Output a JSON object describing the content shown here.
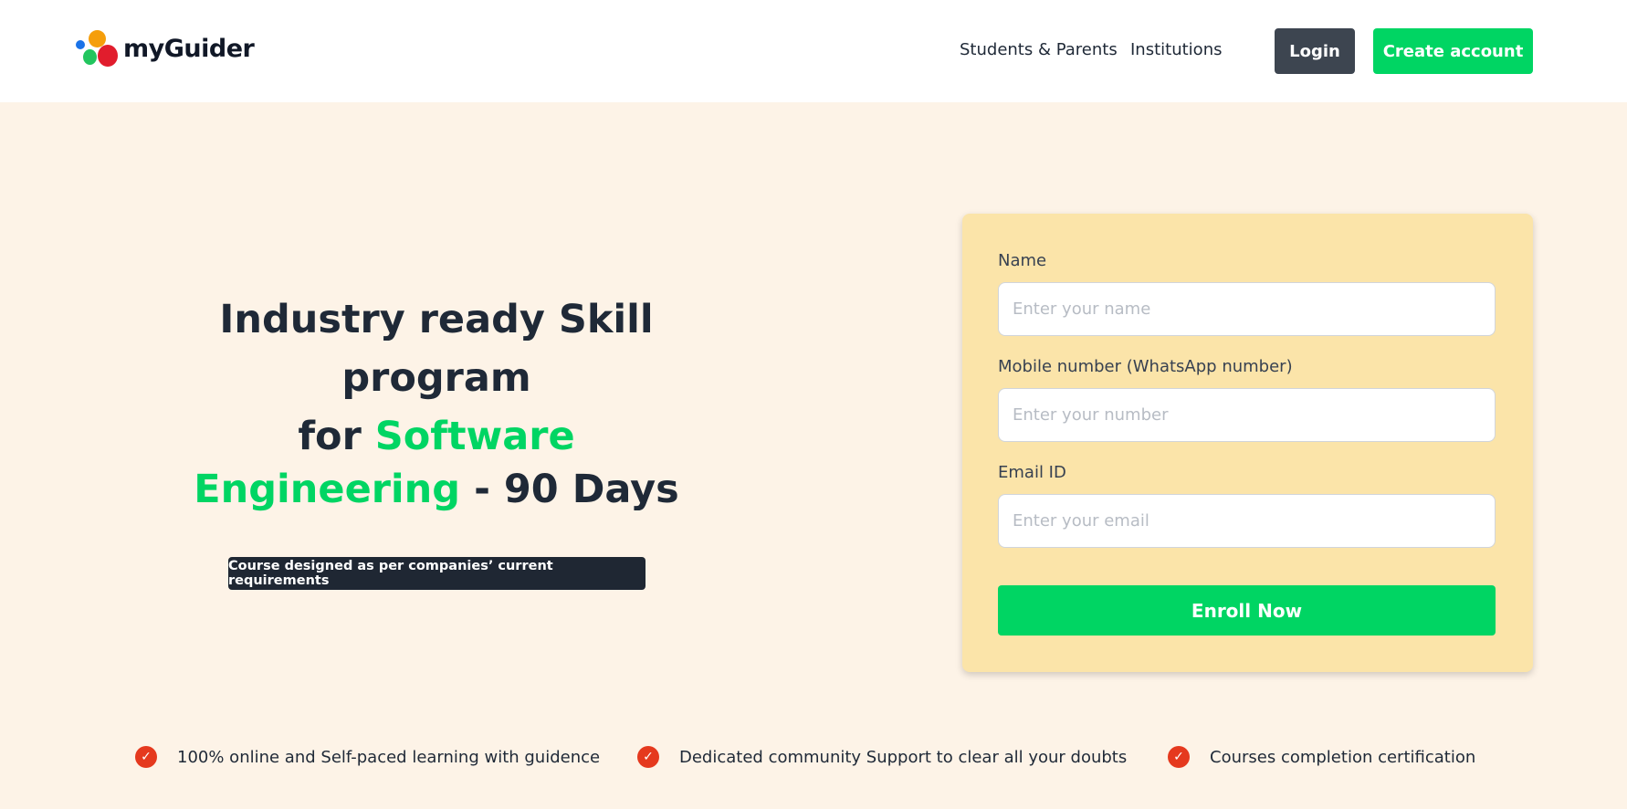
{
  "header": {
    "logo_text": "myGuider",
    "nav": {
      "students_parents": "Students & Parents",
      "institutions": "Institutions"
    },
    "login_label": "Login",
    "create_account_label": "Create account"
  },
  "hero": {
    "title_line1": "Industry ready Skill",
    "title_line2": "program",
    "title_for": "for",
    "title_software": "Software",
    "title_engineering": "Engineering",
    "title_days": "- 90 Days",
    "tagline": "Course designed as per companies’ current requirements"
  },
  "form": {
    "name_label": "Name",
    "name_placeholder": "Enter your name",
    "mobile_label": "Mobile number (WhatsApp number)",
    "mobile_placeholder": "Enter your number",
    "email_label": "Email ID",
    "email_placeholder": "Enter your email",
    "enroll_label": "Enroll Now"
  },
  "features": [
    {
      "text": "100% online and Self-paced learning with guidence",
      "icon": "check-icon"
    },
    {
      "text": "Dedicated community Support to clear all your doubts",
      "icon": "check-icon"
    },
    {
      "text": "Courses completion certification",
      "icon": "check-icon"
    }
  ],
  "colors": {
    "accent_green": "#00d563",
    "hero_background": "#fdf3e7",
    "card_background": "#fbe4a9",
    "check_red": "#e5391e",
    "login_dark": "#3d4550"
  }
}
